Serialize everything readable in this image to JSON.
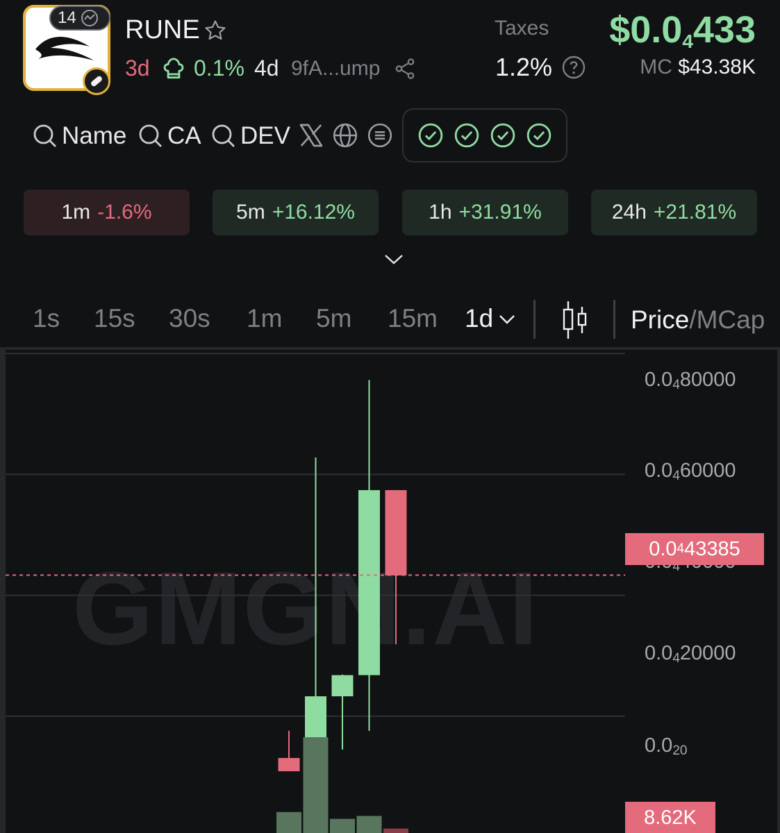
{
  "token": {
    "name": "RUNE",
    "holders_badge": "14",
    "age": "3d",
    "dev_pct": "0.1%",
    "dev_age": "4d",
    "address": "9fA...ump"
  },
  "taxes": {
    "label": "Taxes",
    "value": "1.2%"
  },
  "price": {
    "main": "$0.0",
    "sub": "4",
    "tail": "433"
  },
  "mcap": {
    "label": "MC",
    "value": "$43.38K"
  },
  "links": {
    "name": "Name",
    "ca": "CA",
    "dev": "DEV"
  },
  "changes": [
    {
      "tf": "1m",
      "value": "-1.6%"
    },
    {
      "tf": "5m",
      "value": "+16.12%"
    },
    {
      "tf": "1h",
      "value": "+31.91%"
    },
    {
      "tf": "24h",
      "value": "+21.81%"
    }
  ],
  "timeframes": [
    "1s",
    "15s",
    "30s",
    "1m",
    "5m",
    "15m",
    "1d"
  ],
  "price_mcap": {
    "on": "Price",
    "sep": "/",
    "off": "MCap"
  },
  "colors": {
    "up": "#8fdca2",
    "down": "#e36b7c",
    "gold": "#e1b23c",
    "background": "#111214"
  },
  "chart_data": {
    "type": "candlestick",
    "watermark": "GMGN.AI",
    "y_ticks": [
      {
        "main": "0.0",
        "sub": "4",
        "tail": "80000"
      },
      {
        "main": "0.0",
        "sub": "4",
        "tail": "60000"
      },
      {
        "main": "0.0",
        "sub": "4",
        "tail": "40000"
      },
      {
        "main": "0.0",
        "sub": "4",
        "tail": "20000"
      },
      {
        "main": "0.0",
        "sub": "20",
        "tail": ""
      }
    ],
    "y_tick_values": [
      8e-05,
      6e-05,
      4e-05,
      2e-05,
      0
    ],
    "ylim": [
      0,
      8.06e-05
    ],
    "last_price": {
      "main": "0.0",
      "sub": "4",
      "tail": "43385",
      "value": 4.33385e-05
    },
    "candles": [
      {
        "open": 1.31e-05,
        "high": 1.76e-05,
        "low": 1.09e-05,
        "close": 1.09e-05
      },
      {
        "open": 1.06e-05,
        "high": 6.28e-05,
        "low": 1.06e-05,
        "close": 2.33e-05
      },
      {
        "open": 2.33e-05,
        "high": 2.69e-05,
        "low": 1.45e-05,
        "close": 2.68e-05
      },
      {
        "open": 2.68e-05,
        "high": 7.56e-05,
        "low": 1.76e-05,
        "close": 5.74e-05
      },
      {
        "open": 5.74e-05,
        "high": 5.74e-05,
        "low": 3.19e-05,
        "close": 4.33e-05
      }
    ],
    "volume_label": "8.62K",
    "volume": [
      {
        "value": 0.23,
        "dir": "up"
      },
      {
        "value": 1.0,
        "dir": "up"
      },
      {
        "value": 0.16,
        "dir": "up"
      },
      {
        "value": 0.19,
        "dir": "up"
      },
      {
        "value": 0.06,
        "dir": "down"
      }
    ]
  }
}
